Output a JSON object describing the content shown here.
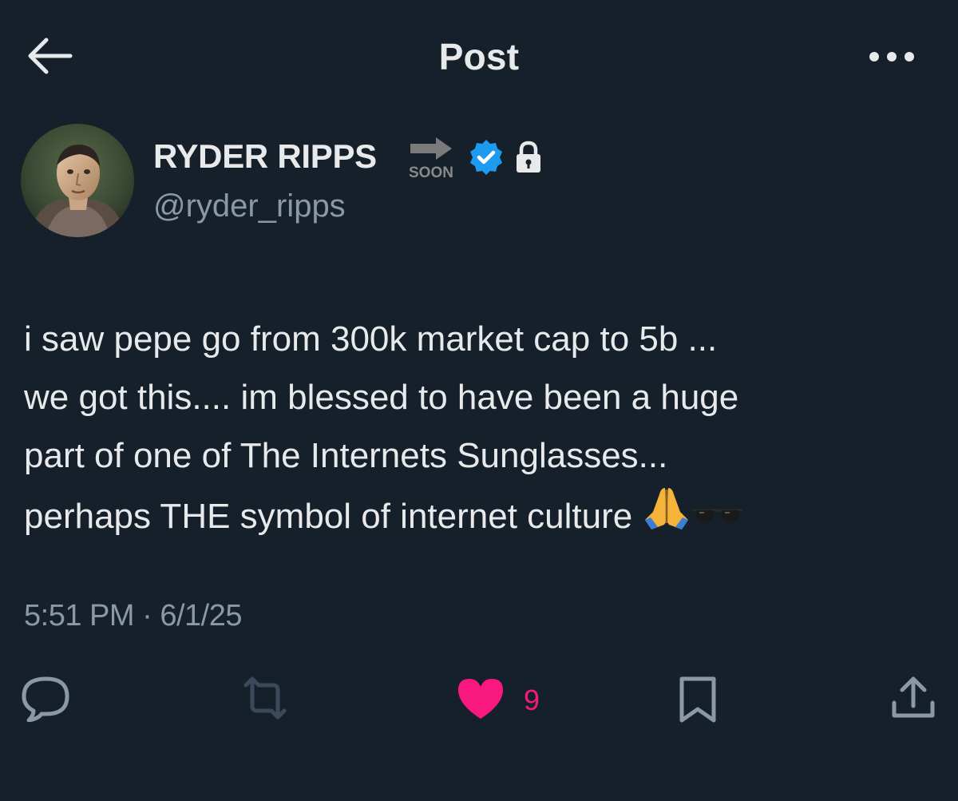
{
  "header": {
    "title": "Post",
    "back_icon": "arrow-left-icon",
    "more_icon": "more-horizontal-icon"
  },
  "author": {
    "display_name": "RYDER RIPPS",
    "badge_text": "SOON",
    "handle": "@ryder_ripps",
    "verified_color": "#1d9bf0",
    "icons": [
      "arrow-soon-icon",
      "verified-badge-icon",
      "lock-icon"
    ]
  },
  "post": {
    "text": "i saw pepe go from 300k market cap to 5b ...\nwe got this.... im blessed to have been a huge\npart of one of The Internets Sunglasses...\nperhaps THE symbol of internet culture ",
    "emojis": [
      "🙏",
      "🕶"
    ],
    "time": "5:51 PM",
    "separator": "·",
    "date": "6/1/25"
  },
  "actions": {
    "reply_icon": "reply-icon",
    "repost_icon": "repost-icon",
    "like_icon": "heart-icon",
    "like_count": "9",
    "like_color": "#f91880",
    "bookmark_icon": "bookmark-icon",
    "share_icon": "share-icon"
  },
  "colors": {
    "background": "#15202b",
    "text_primary": "#e7e9ea",
    "text_secondary": "#8b98a5",
    "icon_muted": "#536471"
  }
}
